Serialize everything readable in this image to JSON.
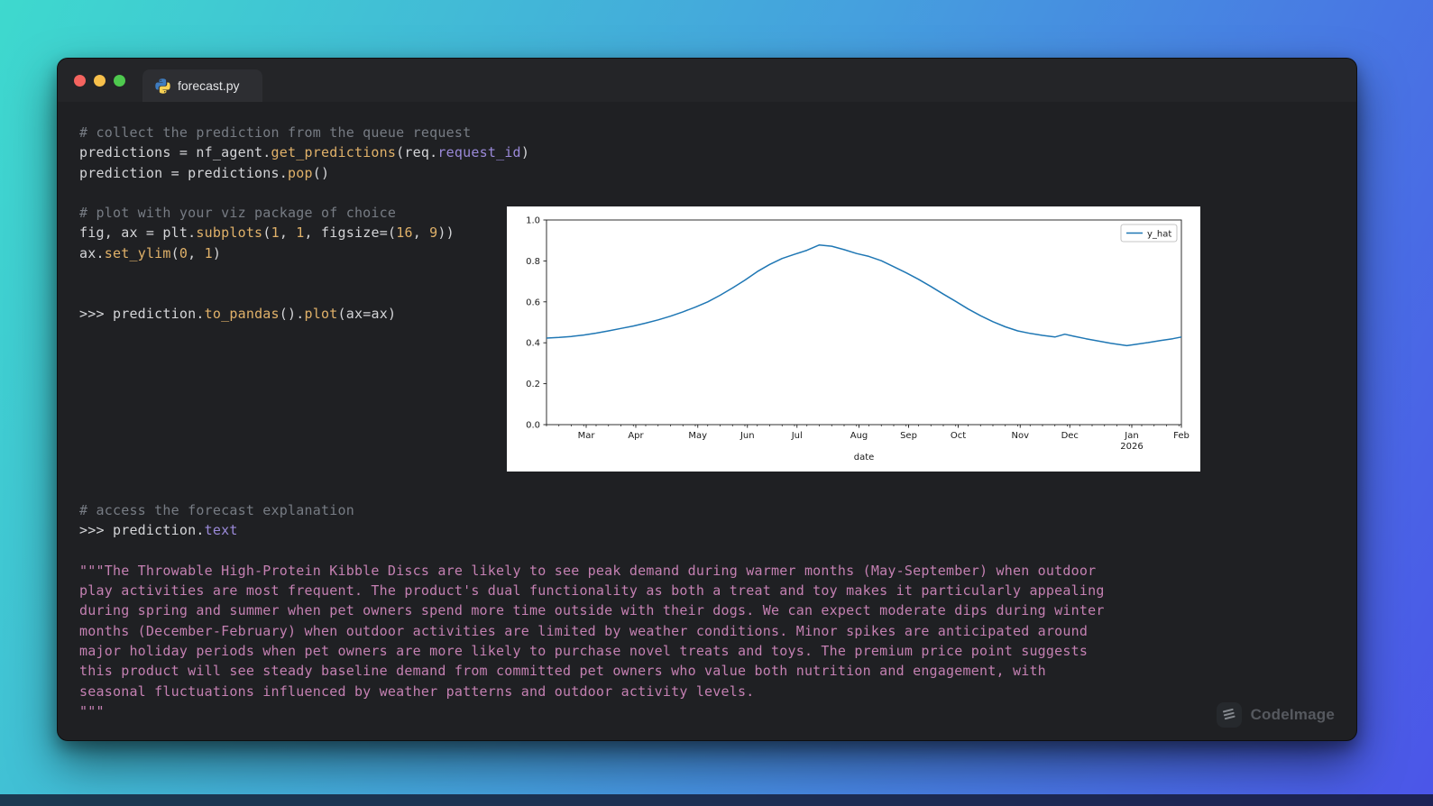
{
  "window": {
    "traffic_lights": {
      "close_color": "#f4645f",
      "minimize_color": "#f7c04b",
      "maximize_color": "#4ec94e"
    },
    "tab": {
      "icon": "python-icon",
      "title": "forecast.py"
    }
  },
  "code_top": {
    "lines": [
      [
        [
          "c",
          "# collect the prediction from the queue request"
        ]
      ],
      [
        [
          "d",
          "predictions = nf_agent."
        ],
        [
          "f",
          "get_predictions"
        ],
        [
          "d",
          "(req."
        ],
        [
          "p",
          "request_id"
        ],
        [
          "d",
          ")"
        ]
      ],
      [
        [
          "d",
          "prediction = predictions."
        ],
        [
          "f",
          "pop"
        ],
        [
          "d",
          "()"
        ]
      ],
      [],
      [
        [
          "c",
          "# plot with your viz package of choice"
        ]
      ],
      [
        [
          "d",
          "fig, ax = plt."
        ],
        [
          "f",
          "subplots"
        ],
        [
          "d",
          "("
        ],
        [
          "n",
          "1"
        ],
        [
          "d",
          ", "
        ],
        [
          "n",
          "1"
        ],
        [
          "d",
          ", figsize=("
        ],
        [
          "n",
          "16"
        ],
        [
          "d",
          ", "
        ],
        [
          "n",
          "9"
        ],
        [
          "d",
          "))"
        ]
      ],
      [
        [
          "d",
          "ax."
        ],
        [
          "f",
          "set_ylim"
        ],
        [
          "d",
          "("
        ],
        [
          "n",
          "0"
        ],
        [
          "d",
          ", "
        ],
        [
          "n",
          "1"
        ],
        [
          "d",
          ")"
        ]
      ],
      [],
      [],
      [
        [
          "d",
          ">>> prediction."
        ],
        [
          "f",
          "to_pandas"
        ],
        [
          "d",
          "()."
        ],
        [
          "f",
          "plot"
        ],
        [
          "d",
          "(ax=ax)"
        ]
      ]
    ]
  },
  "code_bottom": {
    "lines": [
      [
        [
          "c",
          "# access the forecast explanation"
        ]
      ],
      [
        [
          "d",
          ">>> prediction."
        ],
        [
          "p",
          "text"
        ]
      ],
      [],
      [
        [
          "s",
          "\"\"\"The Throwable High-Protein Kibble Discs are likely to see peak demand during warmer months (May-September) when outdoor"
        ]
      ],
      [
        [
          "s",
          "play activities are most frequent. The product's dual functionality as both a treat and toy makes it particularly appealing"
        ]
      ],
      [
        [
          "s",
          "during spring and summer when pet owners spend more time outside with their dogs. We can expect moderate dips during winter"
        ]
      ],
      [
        [
          "s",
          "months (December-February) when outdoor activities are limited by weather conditions. Minor spikes are anticipated around"
        ]
      ],
      [
        [
          "s",
          "major holiday periods when pet owners are more likely to purchase novel treats and toys. The premium price point suggests"
        ]
      ],
      [
        [
          "s",
          "this product will see steady baseline demand from committed pet owners who value both nutrition and engagement, with"
        ]
      ],
      [
        [
          "s",
          "seasonal fluctuations influenced by weather patterns and outdoor activity levels."
        ]
      ],
      [
        [
          "s",
          "\"\"\""
        ]
      ]
    ]
  },
  "chart_data": {
    "type": "line",
    "title": "",
    "xlabel": "date",
    "ylabel": "",
    "ylim": [
      0,
      1
    ],
    "x_unit": "weeks_from_start",
    "x_domain": [
      0,
      51.2
    ],
    "grid": false,
    "y_ticks": [
      0.0,
      0.2,
      0.4,
      0.6,
      0.8,
      1.0
    ],
    "x_ticks": [
      {
        "w": 3.2,
        "label": "Mar"
      },
      {
        "w": 7.2,
        "label": "Apr"
      },
      {
        "w": 12.2,
        "label": "May"
      },
      {
        "w": 16.2,
        "label": "Jun"
      },
      {
        "w": 20.2,
        "label": "Jul"
      },
      {
        "w": 25.2,
        "label": "Aug"
      },
      {
        "w": 29.2,
        "label": "Sep"
      },
      {
        "w": 33.2,
        "label": "Oct"
      },
      {
        "w": 38.2,
        "label": "Nov"
      },
      {
        "w": 42.2,
        "label": "Dec"
      },
      {
        "w": 47.2,
        "label": "Jan",
        "sub": "2026"
      },
      {
        "w": 51.2,
        "label": "Feb"
      }
    ],
    "minor_tick_every": 1,
    "legend": {
      "position": "upper right",
      "entries": [
        {
          "label": "y_hat",
          "color": "#1f77b4"
        }
      ]
    },
    "series": [
      {
        "name": "y_hat",
        "color": "#1f77b4",
        "points": [
          [
            0,
            0.423
          ],
          [
            1,
            0.426
          ],
          [
            2,
            0.431
          ],
          [
            3,
            0.438
          ],
          [
            4,
            0.447
          ],
          [
            5,
            0.458
          ],
          [
            6,
            0.47
          ],
          [
            7,
            0.482
          ],
          [
            8,
            0.496
          ],
          [
            9,
            0.512
          ],
          [
            10,
            0.53
          ],
          [
            11,
            0.551
          ],
          [
            12,
            0.574
          ],
          [
            13,
            0.6
          ],
          [
            14,
            0.632
          ],
          [
            15,
            0.668
          ],
          [
            16,
            0.706
          ],
          [
            17,
            0.748
          ],
          [
            18,
            0.783
          ],
          [
            19,
            0.812
          ],
          [
            20,
            0.832
          ],
          [
            21,
            0.852
          ],
          [
            22,
            0.878
          ],
          [
            23,
            0.872
          ],
          [
            24,
            0.855
          ],
          [
            25,
            0.836
          ],
          [
            26,
            0.822
          ],
          [
            27,
            0.801
          ],
          [
            28,
            0.772
          ],
          [
            29,
            0.742
          ],
          [
            30,
            0.71
          ],
          [
            31,
            0.675
          ],
          [
            32,
            0.638
          ],
          [
            33,
            0.602
          ],
          [
            34,
            0.565
          ],
          [
            35,
            0.532
          ],
          [
            36,
            0.503
          ],
          [
            37,
            0.478
          ],
          [
            38,
            0.458
          ],
          [
            39,
            0.446
          ],
          [
            40,
            0.436
          ],
          [
            41,
            0.428
          ],
          [
            41.8,
            0.442
          ],
          [
            42.5,
            0.432
          ],
          [
            43.5,
            0.42
          ],
          [
            44.5,
            0.409
          ],
          [
            45.5,
            0.398
          ],
          [
            46.8,
            0.386
          ],
          [
            47.5,
            0.392
          ],
          [
            48.5,
            0.401
          ],
          [
            49.5,
            0.411
          ],
          [
            50.5,
            0.42
          ],
          [
            51.2,
            0.428
          ]
        ]
      }
    ]
  },
  "watermark": {
    "icon": "codeimage-icon",
    "label": "CodeImage"
  },
  "colors": {
    "background_gradient": [
      "#3ed9ce",
      "#4b55e8"
    ],
    "window_body": "#1f2023",
    "titlebar": "#242528",
    "tab": "#2d2e32",
    "chart_line": "#1f77b4",
    "token_comment": "#777c84",
    "token_default": "#d4d5d8",
    "token_function": "#e0b169",
    "token_attribute": "#9a89d8",
    "token_string": "#c480b2"
  }
}
